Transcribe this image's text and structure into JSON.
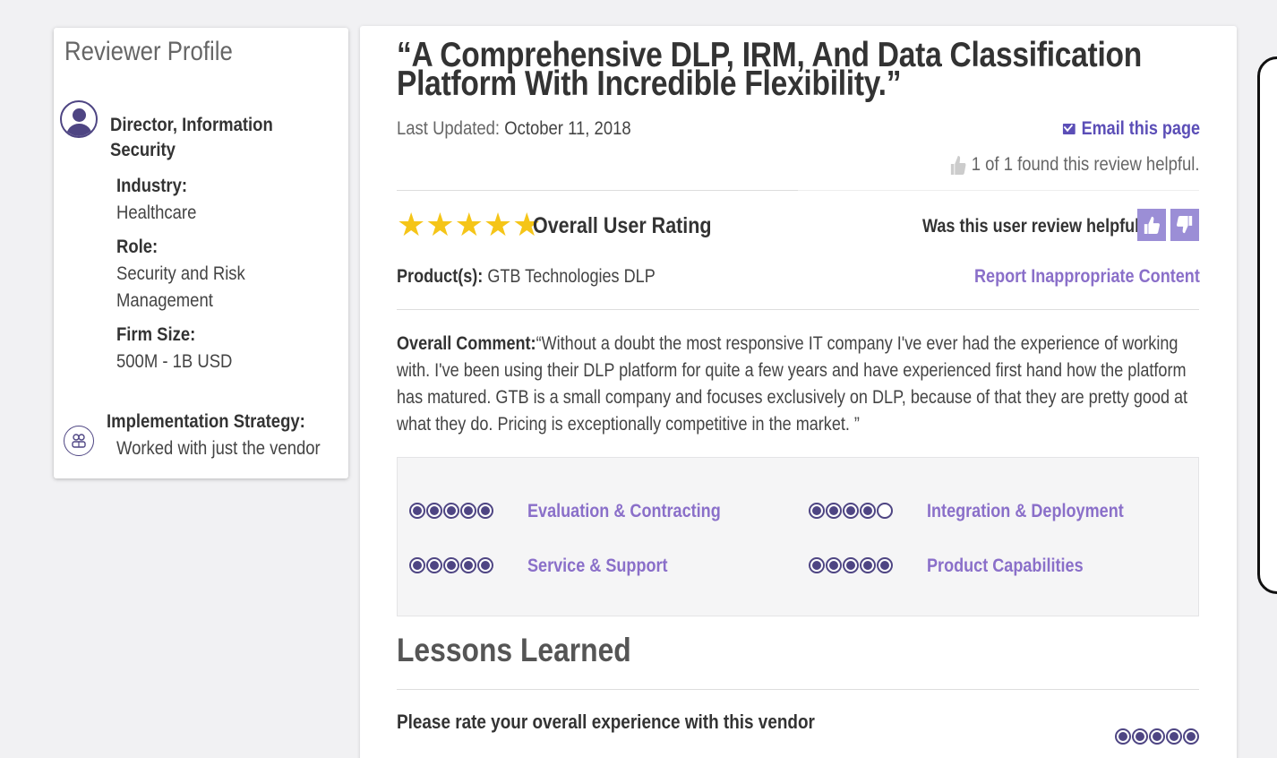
{
  "profile": {
    "heading": "Reviewer Profile",
    "job_title": "Director, Information Security",
    "fields": [
      {
        "label": "Industry:",
        "value": "Healthcare"
      },
      {
        "label": "Role:",
        "value": "Security and Risk Management"
      },
      {
        "label": "Firm Size:",
        "value": "500M - 1B USD"
      }
    ],
    "implementation": {
      "label": "Implementation Strategy:",
      "value": "Worked with just the vendor"
    },
    "icons": {
      "avatar": "user-avatar-icon",
      "implementation": "people-group-icon"
    }
  },
  "review": {
    "title": "“A Comprehensive DLP, IRM, And Data Classification Platform With Incredible Flexibility.”",
    "updated_label": "Last Updated:",
    "updated_date": "October 11, 2018",
    "email_label": "Email this page",
    "helpful_count": "1 of 1 found this review helpful.",
    "overall_label": "Overall User Rating",
    "overall_stars": 5,
    "helpful_question": "Was this user review helpful?",
    "products_label": "Product(s):",
    "products_value": "GTB Technologies DLP",
    "report_label": "Report Inappropriate Content",
    "comment_label": "Overall Comment:",
    "comment_text": "“Without a doubt the most responsive IT company I've ever had the experience of working with. I've been using their DLP platform for quite a few years and have experienced first hand how the platform has matured. GTB is a small company and focuses exclusively on DLP, because of that they are pretty good at what they do. Pricing is exceptionally competitive in the market. ”"
  },
  "ratings": [
    {
      "label": "Evaluation & Contracting",
      "score": 5
    },
    {
      "label": "Integration & Deployment",
      "score": 4
    },
    {
      "label": "Service & Support",
      "score": 5
    },
    {
      "label": "Product Capabilities",
      "score": 5
    }
  ],
  "lessons": {
    "heading": "Lessons Learned",
    "question": "Please rate your overall experience with this vendor",
    "score": 5
  },
  "colors": {
    "accent": "#4e4583",
    "link": "#8a6fc9",
    "star": "#f5c518",
    "vote": "#9b8ed6"
  }
}
